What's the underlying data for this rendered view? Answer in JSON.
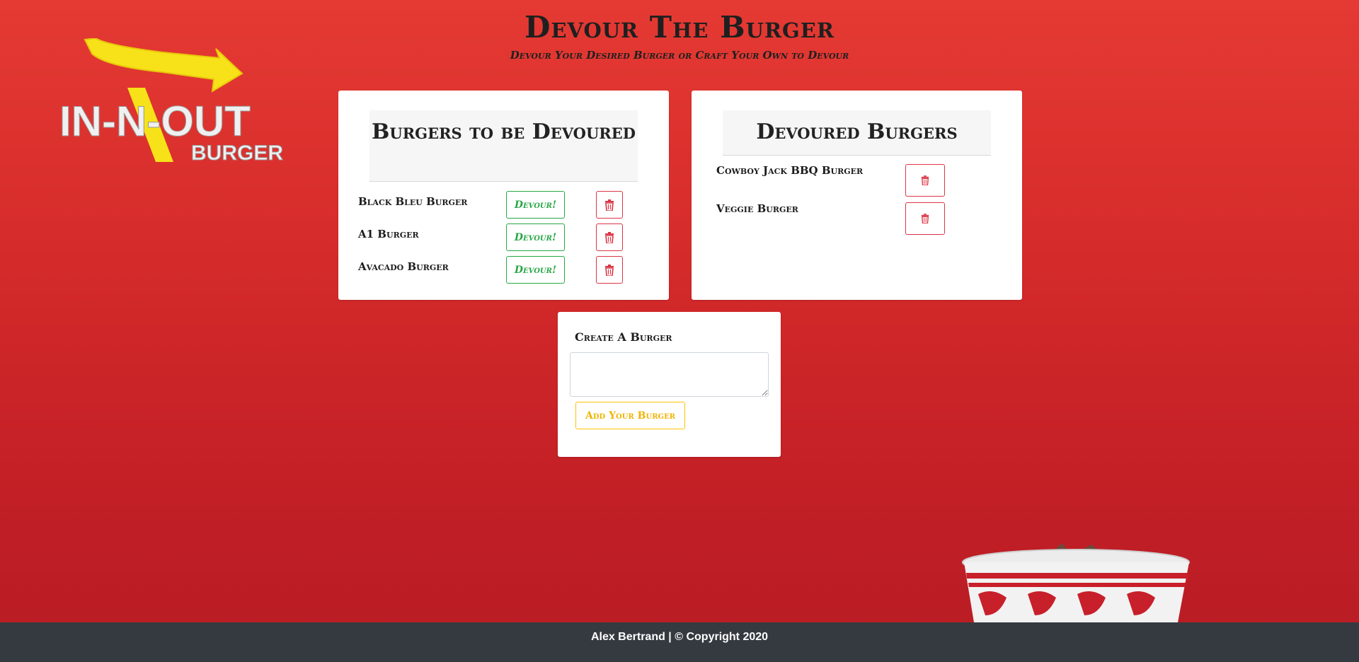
{
  "header": {
    "title": "Devour The Burger",
    "subtitle": "Devour Your Desired Burger or Craft Your Own to Devour"
  },
  "logo": {
    "line1": "IN-N-OUT",
    "line2": "BURGER"
  },
  "to_devour": {
    "title": "Burgers to be Devoured",
    "devour_label": "Devour!",
    "items": [
      {
        "name": "Black Bleu Burger"
      },
      {
        "name": "A1 Burger"
      },
      {
        "name": "Avacado Burger"
      }
    ]
  },
  "devoured": {
    "title": "Devoured Burgers",
    "items": [
      {
        "name": "Cowboy Jack BBQ Burger"
      },
      {
        "name": "Veggie Burger"
      }
    ]
  },
  "form": {
    "label": "Create A Burger",
    "textarea_value": "",
    "submit_label": "Add Your Burger"
  },
  "footer": {
    "text": "Alex Bertrand | © Copyright 2020"
  },
  "icons": {
    "trash": "trash-icon",
    "logo_arrow": "arrow-icon"
  },
  "colors": {
    "background": "#d42a2a",
    "devour": "#28a745",
    "delete": "#dc3545",
    "add": "#ffc107",
    "footer": "#343a40"
  }
}
